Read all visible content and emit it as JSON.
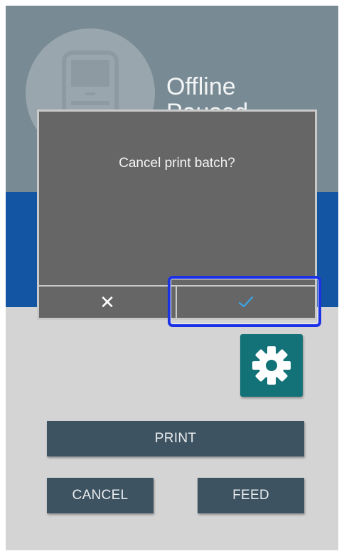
{
  "status": {
    "line1": "Offline",
    "line2": "Paused",
    "icon": "printer-icon"
  },
  "controls": {
    "settings_icon": "gear-icon",
    "print_label": "PRINT",
    "cancel_label": "CANCEL",
    "feed_label": "FEED"
  },
  "dialog": {
    "message": "Cancel print batch?",
    "no_symbol": "✕",
    "yes_symbol": "✓"
  },
  "colors": {
    "header": "#788a93",
    "band": "#1455a3",
    "button": "#3e5361",
    "settings_button": "#127278",
    "dialog": "#666666",
    "check_accent": "#3ba5e5",
    "focus_ring": "#1a31e6"
  }
}
